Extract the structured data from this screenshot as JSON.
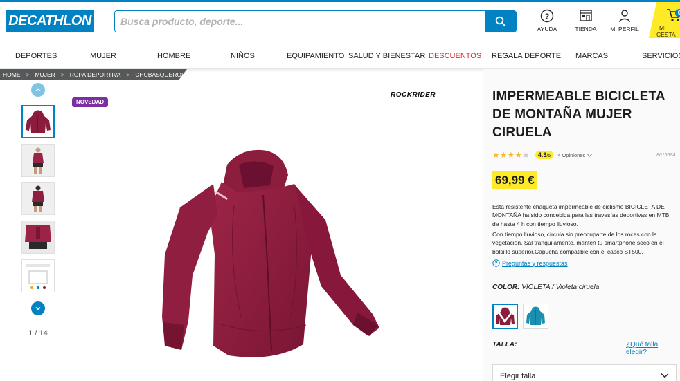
{
  "brand": {
    "logo_text": "DECATHLON",
    "accent": "#0082c3",
    "yellow": "#ffea28"
  },
  "search": {
    "placeholder": "Busca producto, deporte..."
  },
  "header_icons": [
    {
      "label": "AYUDA",
      "icon": "help-icon"
    },
    {
      "label": "TIENDA",
      "icon": "store-icon"
    },
    {
      "label": "MI PERFIL",
      "icon": "user-icon"
    }
  ],
  "cart": {
    "label": "MI CESTA",
    "count": "0"
  },
  "nav": [
    "DEPORTES",
    "MUJER",
    "HOMBRE",
    "NIÑOS",
    "EQUIPAMIENTO",
    "SALUD Y BIENESTAR",
    "DESCUENTOS",
    "REGALA DEPORTE",
    "MARCAS",
    "SERVICIOS"
  ],
  "breadcrumb": [
    "HOME",
    "MUJER",
    "ROPA DEPORTIVA",
    "CHUBASQUEROS"
  ],
  "gallery": {
    "pager": "1 / 14",
    "badge": "NOVEDAD",
    "brand_mark": "ROCKRIDER"
  },
  "product": {
    "title": "IMPERMEABLE BICICLETA DE MONTAÑA MUJER CIRUELA",
    "rating_value": "4.3",
    "rating_scale": "/5",
    "rating_stars": 4.3,
    "opinions": "4 Opiniones",
    "reference": "8615584",
    "price": "69,99 €",
    "desc_1": "Esta resistente chaqueta impermeable de ciclismo BICICLETA DE MONTAÑA ha sido concebida para las travesías deportivas en MTB de hasta 4 h con tiempo lluvioso.",
    "desc_2": "Con tiempo lluvioso, circula sin preocuparte de los roces con la vegetación. Sal tranquilamente, mantén tu smartphone seco en el bolsillo superior.Capucha compatible con el casco ST500.",
    "qa_link": "Preguntas y respuestas",
    "color_label": "COLOR:",
    "color_value": "VIOLETA / Violeta ciruela",
    "size_label": "TALLA:",
    "size_guide": "¿Qué talla elegir?",
    "size_select": "Elegir talla"
  }
}
